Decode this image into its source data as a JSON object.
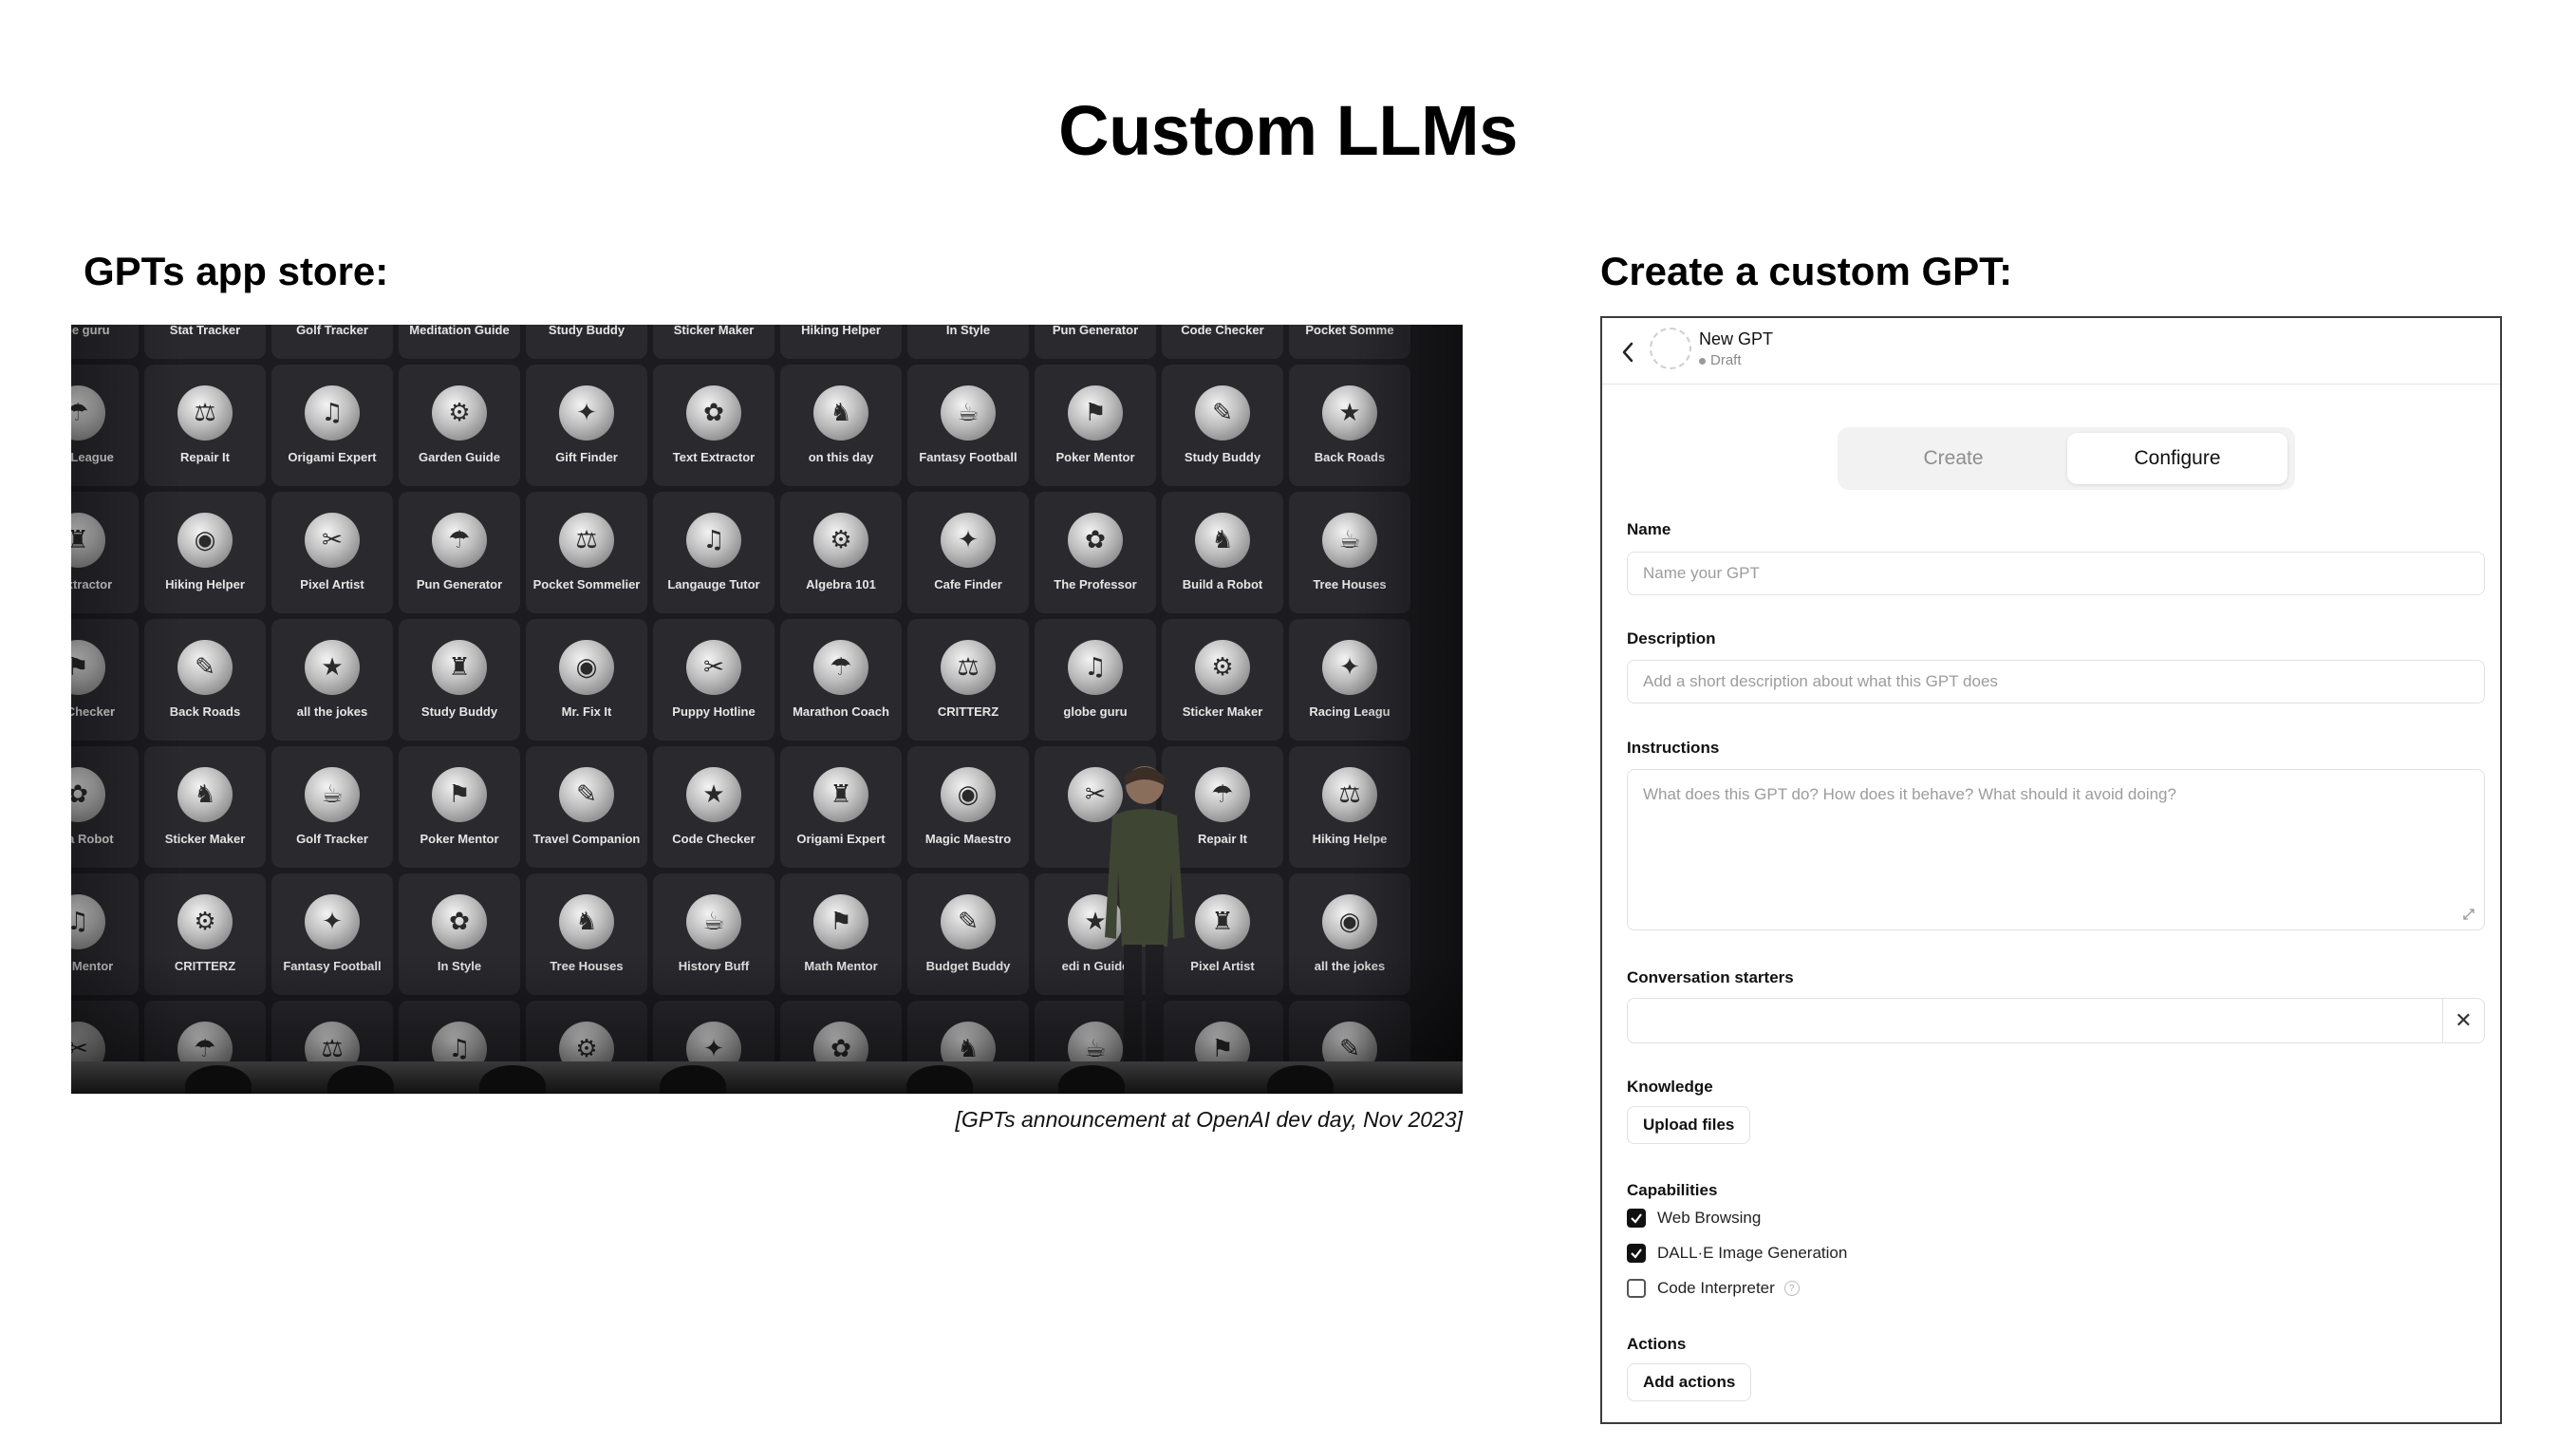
{
  "slide": {
    "title": "Custom LLMs",
    "left_heading": "GPTs app store:",
    "right_heading": "Create a custom GPT:",
    "caption": "[GPTs announcement at OpenAI dev day, Nov 2023]"
  },
  "app_store": {
    "rows": [
      [
        "globe guru",
        "Stat Tracker",
        "Golf Tracker",
        "Meditation Guide",
        "Study Buddy",
        "Sticker Maker",
        "Hiking Helper",
        "In Style",
        "Pun Generator",
        "Code Checker",
        "Pocket Somme"
      ],
      [
        "cing League",
        "Repair It",
        "Origami Expert",
        "Garden Guide",
        "Gift Finder",
        "Text Extractor",
        "on this day",
        "Fantasy Football",
        "Poker Mentor",
        "Study Buddy",
        "Back Roads"
      ],
      [
        "xt Extractor",
        "Hiking Helper",
        "Pixel Artist",
        "Pun Generator",
        "Pocket Sommelier",
        "Langauge Tutor",
        "Algebra 101",
        "Cafe Finder",
        "The Professor",
        "Build a Robot",
        "Tree Houses"
      ],
      [
        "ode Checker",
        "Back Roads",
        "all the jokes",
        "Study Buddy",
        "Mr. Fix It",
        "Puppy Hotline",
        "Marathon Coach",
        "CRITTERZ",
        "globe guru",
        "Sticker Maker",
        "Racing Leagu"
      ],
      [
        "uild a Robot",
        "Sticker Maker",
        "Golf Tracker",
        "Poker Mentor",
        "Travel Companion",
        "Code Checker",
        "Origami Expert",
        "Magic Maestro",
        "",
        "Repair It",
        "Hiking Helpe"
      ],
      [
        "oker Mentor",
        "CRITTERZ",
        "Fantasy Football",
        "In Style",
        "Tree Houses",
        "History Buff",
        "Math Mentor",
        "Budget Buddy",
        "edi   n Guide",
        "Pixel Artist",
        "all the jokes"
      ],
      [
        "",
        "",
        "",
        "",
        "",
        "",
        "",
        "",
        "",
        "",
        ""
      ]
    ]
  },
  "builder": {
    "header": {
      "name": "New GPT",
      "status": "Draft"
    },
    "tabs": {
      "create": "Create",
      "configure": "Configure",
      "active": "configure"
    },
    "name": {
      "label": "Name",
      "placeholder": "Name your GPT"
    },
    "description": {
      "label": "Description",
      "placeholder": "Add a short description about what this GPT does"
    },
    "instructions": {
      "label": "Instructions",
      "placeholder": "What does this GPT do? How does it behave? What should it avoid doing?"
    },
    "starters": {
      "label": "Conversation starters",
      "value": ""
    },
    "knowledge": {
      "label": "Knowledge",
      "button": "Upload files"
    },
    "capabilities": {
      "label": "Capabilities",
      "items": [
        {
          "label": "Web Browsing",
          "checked": true
        },
        {
          "label": "DALL·E Image Generation",
          "checked": true
        },
        {
          "label": "Code Interpreter",
          "checked": false
        }
      ]
    },
    "actions": {
      "label": "Actions",
      "button": "Add actions"
    }
  },
  "icons": {
    "back": "chevron-left-icon",
    "clear": "close-icon",
    "resize": "resize-handle-icon",
    "help": "help-circle-icon",
    "check": "checkmark-icon"
  }
}
